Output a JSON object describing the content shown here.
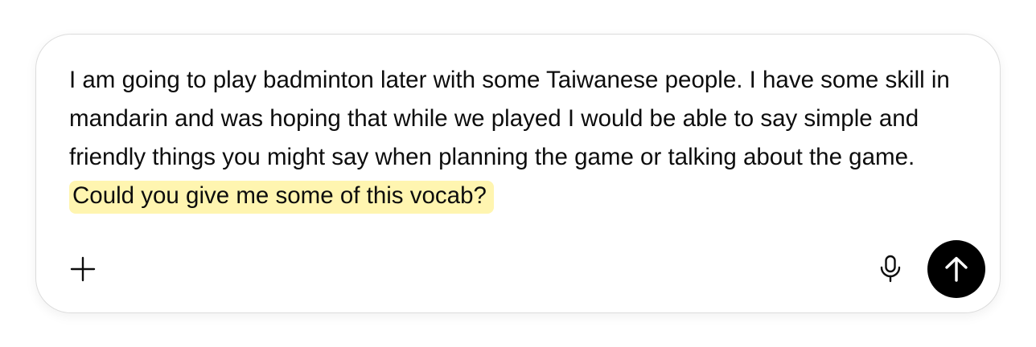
{
  "composer": {
    "text_plain": "I am going to play badminton later with some Taiwanese people. I have some skill in mandarin and was hoping that while we played I would be able to say simple and friendly things you might say when planning the game or talking about the game.",
    "text_highlighted": "Could you give me some of this vocab?",
    "highlight_color": "#fff5b0"
  },
  "toolbar": {
    "add_icon": "plus-icon",
    "mic_icon": "microphone-icon",
    "send_icon": "arrow-up-icon",
    "send_button_color": "#000000"
  }
}
